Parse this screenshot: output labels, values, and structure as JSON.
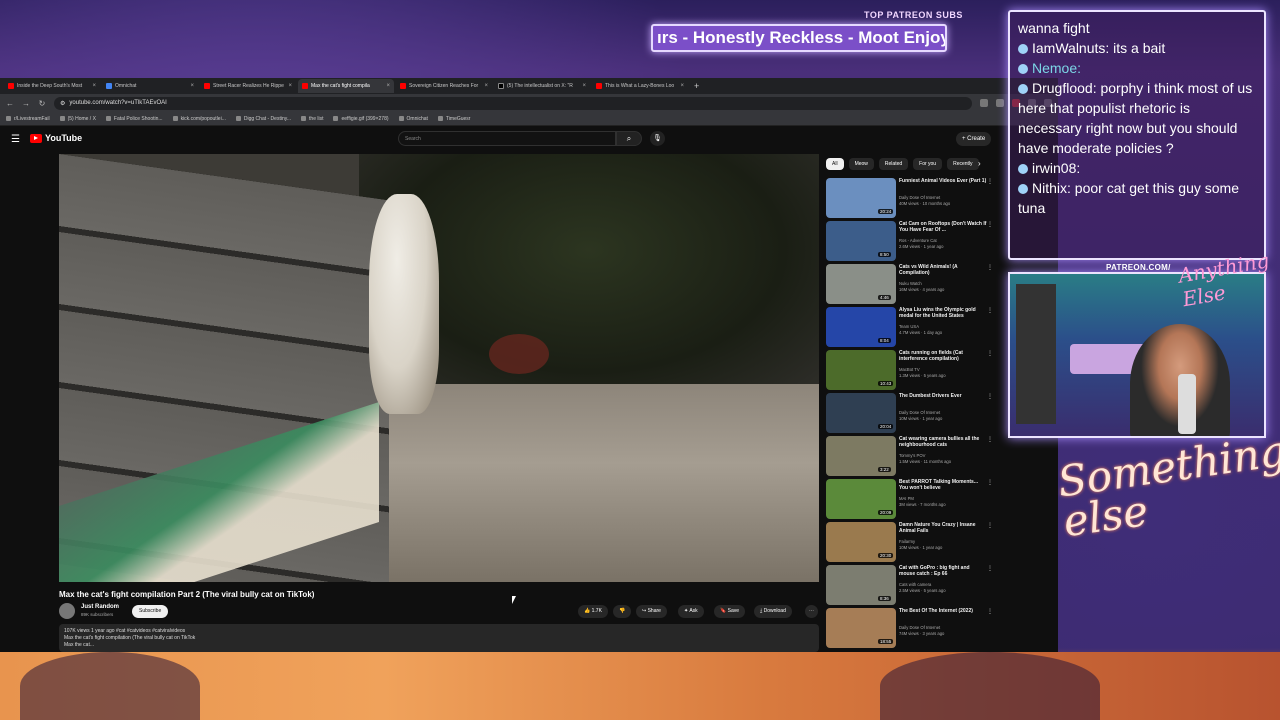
{
  "overlay": {
    "patreon_label": "TOP PATREON SUBS",
    "ticker_text": "ırs - Honestly Reckless - Moot Enjoye",
    "patreon_url": "PATREON.COM/",
    "anything_else": "Anything Else",
    "something_else": "Something else"
  },
  "browser": {
    "tabs": [
      {
        "label": "Inside the Deep South's Most",
        "active": false,
        "icon": "youtube-icon"
      },
      {
        "label": "Omnichat",
        "active": false,
        "icon": "omnichat-icon"
      },
      {
        "label": "Street Racer Realizes He Rippe",
        "active": false,
        "icon": "youtube-icon"
      },
      {
        "label": "Max the cat's fight compila",
        "active": true,
        "icon": "youtube-icon"
      },
      {
        "label": "Sovereign Citizen Reaches For",
        "active": false,
        "icon": "youtube-icon"
      },
      {
        "label": "(5) The intellectualist on X: \"R",
        "active": false,
        "icon": "x-icon"
      },
      {
        "label": "This is What a Lazy-Bones Loo",
        "active": false,
        "icon": "youtube-icon"
      }
    ],
    "url": "youtube.com/watch?v=uTlkTAEvOAI",
    "bookmarks": [
      "r/LivestreamFail",
      "(5) Home / X",
      "Fatal Police Shootin...",
      "kick.com/popoutlei...",
      "Digg Chat - Destiny...",
      "the list",
      "eeffigie.gif (399×278)",
      "Omnichat",
      "TimeGuesr"
    ]
  },
  "youtube": {
    "logo": "YouTube",
    "search_placeholder": "Search",
    "create_label": "Create",
    "video_title": "Max the cat's fight compilation Part 2 (The viral bully cat on TikTok)",
    "channel_name": "Just Random",
    "channel_subs": "89K subscribers",
    "subscribe_label": "Subscribe",
    "likes": "1.7K",
    "share_label": "Share",
    "ask_label": "Ask",
    "save_label": "Save",
    "download_label": "Download",
    "description_line1": "107K views  1 year ago  #cat #catvideos #catviralvideos",
    "description_line2": "Max the cat's fight compilation (The viral bully cat on TikTok",
    "description_line3": "Max the cat...",
    "chips": [
      "All",
      "Meow",
      "Related",
      "For you",
      "Recently"
    ],
    "recommendations": [
      {
        "title": "Funniest Animal Videos Ever (Part 1)",
        "channel": "Daily Dose Of Internet",
        "meta": "40M views · 10 months ago",
        "duration": "20:24",
        "color": "#6b8fbf"
      },
      {
        "title": "Cat Cam on Rooftops (Don't Watch If You Have Fear Of ...",
        "channel": "Ros - Adventure Cat",
        "meta": "2.6M views · 1 year ago",
        "duration": "8:50",
        "color": "#3c5d8a"
      },
      {
        "title": "Cats vs Wild Animals! (A Compilation)",
        "channel": "Nuku Watch",
        "meta": "16M views · 4 years ago",
        "duration": "4:46",
        "color": "#8a8f88"
      },
      {
        "title": "Alysa Liu wins the Olympic gold medal for the United States",
        "channel": "Team USA",
        "meta": "4.7M views · 1 day ago",
        "duration": "8:04",
        "color": "#2546a8"
      },
      {
        "title": "Cats running on fields (Cat interference compilation)",
        "channel": "MacBot TV",
        "meta": "1.3M views · 5 years ago",
        "duration": "10:43",
        "color": "#4c6b2a"
      },
      {
        "title": "The Dumbest Drivers Ever",
        "channel": "Daily Dose Of Internet",
        "meta": "10M views · 1 year ago",
        "duration": "20:04",
        "color": "#2f3f52"
      },
      {
        "title": "Cat wearing camera bullies all the neighbourhood cats",
        "channel": "Tommy's POV",
        "meta": "1.5M views · 11 months ago",
        "duration": "3:22",
        "color": "#7d7a62"
      },
      {
        "title": "Best PARROT Talking Moments... You won't believe",
        "channel": "MAI PM",
        "meta": "3M views · 7 months ago",
        "duration": "20:09",
        "color": "#5b8a3a"
      },
      {
        "title": "Damn Nature You Crazy | Insane Animal Fails",
        "channel": "Failarmy",
        "meta": "10M views · 1 year ago",
        "duration": "20:30",
        "color": "#9a7a4e"
      },
      {
        "title": "Cat with GoPro : big fight and mouse catch : Ep 66",
        "channel": "Cats with camera",
        "meta": "2.5M views · 5 years ago",
        "duration": "8:36",
        "color": "#7c7d70"
      },
      {
        "title": "The Best Of The Internet (2022)",
        "channel": "Daily Dose Of Internet",
        "meta": "74M views · 3 years ago",
        "duration": "18:55",
        "color": "#a67d56"
      }
    ]
  },
  "chat": [
    {
      "user": "",
      "text": "wanna fight",
      "teal": false,
      "badge": false
    },
    {
      "user": "IamWalnuts:",
      "text": " its a bait",
      "teal": false,
      "badge": true
    },
    {
      "user": "Nemoe:",
      "text": "",
      "teal": true,
      "badge": true
    },
    {
      "user": "Drugflood:",
      "text": " porphy i think most of us here that populist rhetoric is necessary right now but you should have moderate policies ?",
      "teal": false,
      "badge": true
    },
    {
      "user": "irwin08:",
      "text": "",
      "teal": false,
      "badge": true
    },
    {
      "user": "Nithix:",
      "text": " poor cat  get this guy some tuna",
      "teal": false,
      "badge": true
    }
  ]
}
